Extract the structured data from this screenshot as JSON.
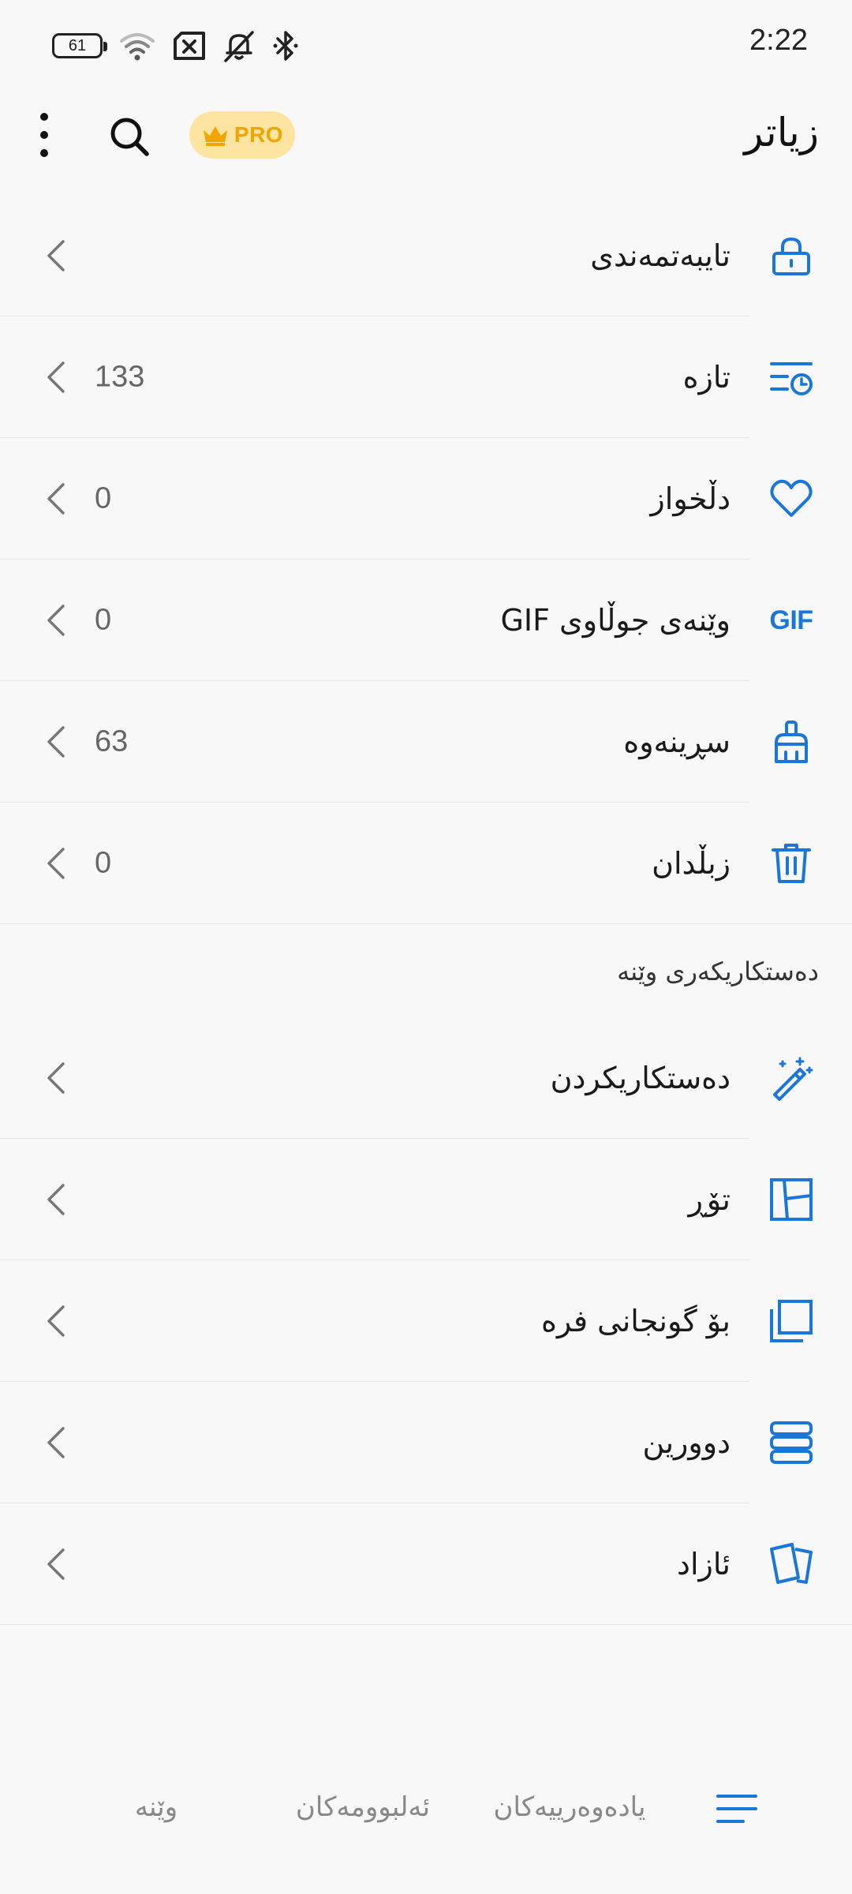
{
  "status_bar": {
    "battery_level": "61",
    "time": "2:22"
  },
  "header": {
    "title": "زیاتر",
    "pro_label": "PRO"
  },
  "items": [
    {
      "label": "تایبەتمەندی",
      "count": "",
      "icon": "lock-icon"
    },
    {
      "label": "تازە",
      "count": "133",
      "icon": "recent-list-icon"
    },
    {
      "label": "دڵخواز",
      "count": "0",
      "icon": "heart-icon"
    },
    {
      "label": "وێنەی جوڵاوی GIF",
      "count": "0",
      "icon": "gif-icon",
      "icon_text": "GIF"
    },
    {
      "label": "سڕینەوە",
      "count": "63",
      "icon": "broom-icon"
    },
    {
      "label": "زبڵدان",
      "count": "0",
      "icon": "trash-icon"
    }
  ],
  "editor_section": {
    "header": "دەستکاریکەری وێنە",
    "items": [
      {
        "label": "دەستکاریکردن",
        "icon": "magic-wand-icon"
      },
      {
        "label": "تۆڕ",
        "icon": "collage-grid-icon"
      },
      {
        "label": "بۆ گونجانی فرە",
        "icon": "layers-icon"
      },
      {
        "label": "دوورین",
        "icon": "stack-icon"
      },
      {
        "label": "ئازاد",
        "icon": "free-cards-icon"
      }
    ]
  },
  "bottom_nav": {
    "items": [
      {
        "label": "وێنە"
      },
      {
        "label": "ئەلبوومەکان"
      },
      {
        "label": "یادەوەرییەکان"
      }
    ],
    "active_icon": "menu-lines-icon"
  },
  "colors": {
    "accent": "#1b76d9",
    "pro_bg": "#fde4a0",
    "pro_text": "#f2a500",
    "background": "#f8f8f8"
  }
}
